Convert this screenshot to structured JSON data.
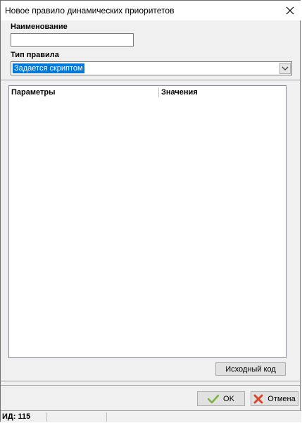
{
  "window": {
    "title": "Новое правило динамических приоритетов"
  },
  "form": {
    "name_label": "Наименование",
    "name_value": "",
    "type_label": "Тип правила",
    "type_value": "Задается скриптом"
  },
  "grid": {
    "columns": [
      "Параметры",
      "Значения"
    ],
    "rows": []
  },
  "buttons": {
    "source_code": "Исходный код",
    "ok": "OK",
    "cancel": "Отмена"
  },
  "status": {
    "id_label": "ИД:",
    "id_value": "115"
  },
  "colors": {
    "selection": "#0078d7",
    "ok_icon": "#7cb342",
    "cancel_icon": "#d9452b"
  },
  "icons": {
    "close": "close-icon",
    "dropdown": "chevron-down-icon",
    "ok": "checkmark-icon",
    "cancel": "x-icon"
  }
}
